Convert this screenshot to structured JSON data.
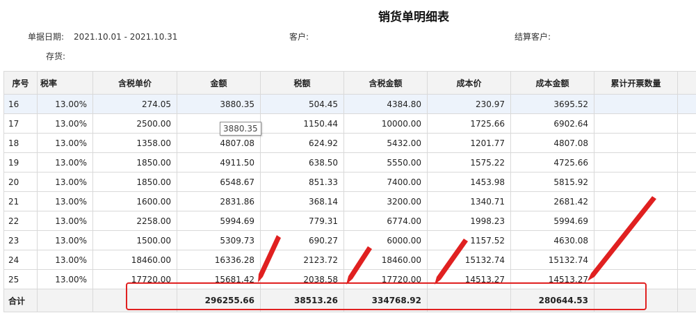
{
  "report": {
    "title": "销货单明细表",
    "date_label": "单据日期:",
    "date_range": "2021.10.01 - 2021.10.31",
    "customer_label": "客户:",
    "settle_customer_label": "结算客户:",
    "stock_label": "存货:"
  },
  "table": {
    "headers": [
      "序号",
      "税率",
      "含税单价",
      "金额",
      "税额",
      "含税金额",
      "成本价",
      "成本金额",
      "累计开票数量",
      "累计"
    ],
    "rows": [
      [
        "16",
        "13.00%",
        "274.05",
        "3880.35",
        "504.45",
        "4384.80",
        "230.97",
        "3695.52",
        "",
        ""
      ],
      [
        "17",
        "13.00%",
        "2500.00",
        "",
        "1150.44",
        "10000.00",
        "1725.66",
        "6902.64",
        "",
        ""
      ],
      [
        "18",
        "13.00%",
        "1358.00",
        "4807.08",
        "624.92",
        "5432.00",
        "1201.77",
        "4807.08",
        "",
        ""
      ],
      [
        "19",
        "13.00%",
        "1850.00",
        "4911.50",
        "638.50",
        "5550.00",
        "1575.22",
        "4725.66",
        "",
        ""
      ],
      [
        "20",
        "13.00%",
        "1850.00",
        "6548.67",
        "851.33",
        "7400.00",
        "1453.98",
        "5815.92",
        "",
        ""
      ],
      [
        "21",
        "13.00%",
        "1600.00",
        "2831.86",
        "368.14",
        "3200.00",
        "1340.71",
        "2681.42",
        "",
        ""
      ],
      [
        "22",
        "13.00%",
        "2258.00",
        "5994.69",
        "779.31",
        "6774.00",
        "1998.23",
        "5994.69",
        "",
        ""
      ],
      [
        "23",
        "13.00%",
        "1500.00",
        "5309.73",
        "690.27",
        "6000.00",
        "1157.52",
        "4630.08",
        "",
        ""
      ],
      [
        "24",
        "13.00%",
        "18460.00",
        "16336.28",
        "2123.72",
        "18460.00",
        "15132.74",
        "15132.74",
        "",
        ""
      ],
      [
        "25",
        "13.00%",
        "17720.00",
        "15681.42",
        "2038.58",
        "17720.00",
        "14513.27",
        "14513.27",
        "",
        ""
      ]
    ],
    "total": [
      "合计",
      "",
      "",
      "296255.66",
      "38513.26",
      "334768.92",
      "",
      "280644.53",
      "",
      ""
    ]
  },
  "tooltip": {
    "text": "3880.35"
  },
  "colors": {
    "header_bg": "#f3f3f3",
    "highlight_row": "#edf3fb",
    "annotation": "#e02020"
  }
}
